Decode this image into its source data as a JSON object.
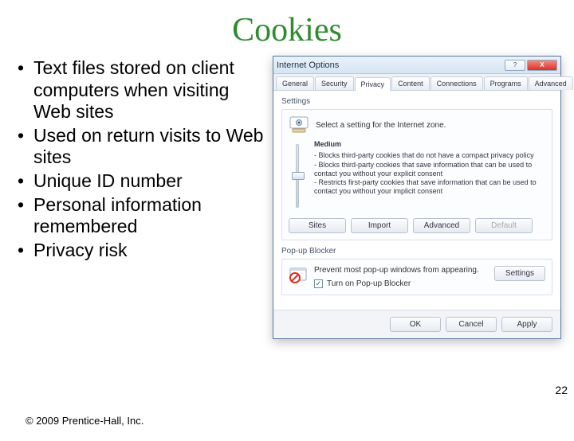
{
  "slide": {
    "title": "Cookies",
    "bullets": [
      "Text files stored on client computers when visiting Web sites",
      "Used on return visits to Web sites",
      "Unique ID number",
      "Personal information remembered",
      "Privacy risk"
    ],
    "copyright": "© 2009 Prentice-Hall, Inc.",
    "page_number": "22"
  },
  "dialog": {
    "title": "Internet Options",
    "window_buttons": {
      "help": "?",
      "close": "X"
    },
    "tabs": [
      "General",
      "Security",
      "Privacy",
      "Content",
      "Connections",
      "Programs",
      "Advanced"
    ],
    "active_tab": "Privacy",
    "settings": {
      "group_label": "Settings",
      "zone_text": "Select a setting for the Internet zone.",
      "level": "Medium",
      "desc": [
        "- Blocks third-party cookies that do not have a compact privacy policy",
        "- Blocks third-party cookies that save information that can be used to contact you without your explicit consent",
        "- Restricts first-party cookies that save information that can be used to contact you without your implicit consent"
      ],
      "buttons": {
        "sites": "Sites",
        "import": "Import",
        "advanced": "Advanced",
        "default": "Default"
      }
    },
    "popup": {
      "group_label": "Pop-up Blocker",
      "desc": "Prevent most pop-up windows from appearing.",
      "settings_btn": "Settings",
      "checkbox_label": "Turn on Pop-up Blocker",
      "checked": true
    },
    "footer": {
      "ok": "OK",
      "cancel": "Cancel",
      "apply": "Apply"
    }
  }
}
